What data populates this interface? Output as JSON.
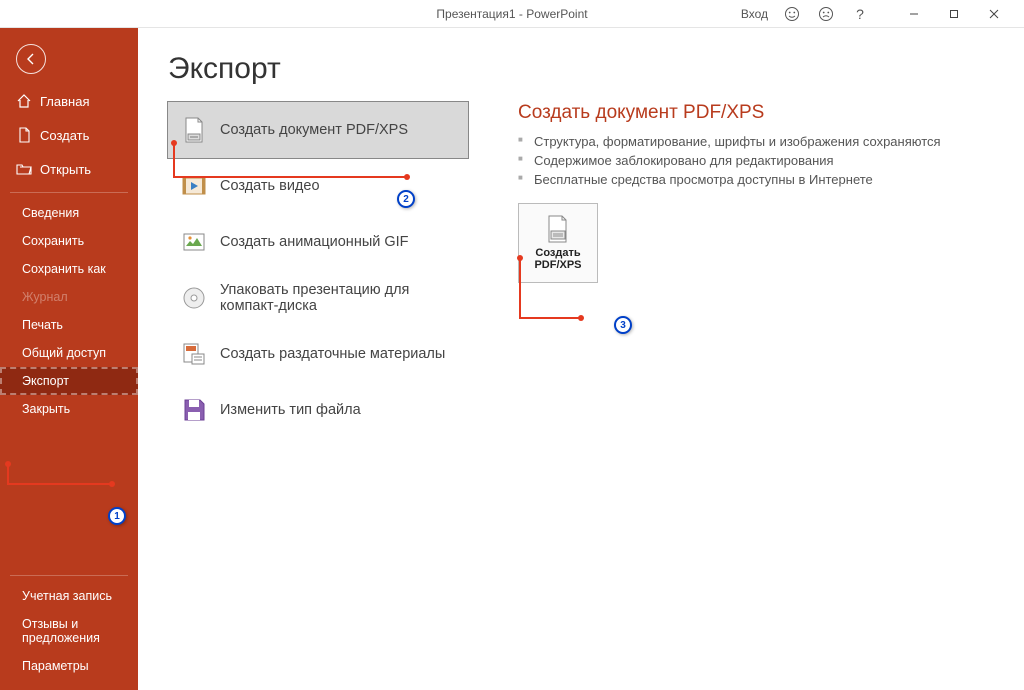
{
  "app": {
    "title": "Презентация1  -  PowerPoint",
    "signin": "Вход"
  },
  "sidebar": {
    "home": "Главная",
    "new": "Создать",
    "open": "Открыть",
    "info": "Сведения",
    "save": "Сохранить",
    "saveas": "Сохранить как",
    "history": "Журнал",
    "print": "Печать",
    "share": "Общий доступ",
    "export": "Экспорт",
    "close": "Закрыть",
    "account": "Учетная запись",
    "feedback": "Отзывы и предложения",
    "options": "Параметры"
  },
  "page": {
    "heading": "Экспорт",
    "options": {
      "pdf": "Создать документ PDF/XPS",
      "video": "Создать видео",
      "gif": "Создать анимационный GIF",
      "packcd": "Упаковать презентацию для компакт-диска",
      "handouts": "Создать раздаточные материалы",
      "changetype": "Изменить тип файла"
    }
  },
  "details": {
    "title": "Создать документ PDF/XPS",
    "b1": "Структура, форматирование, шрифты и изображения сохраняются",
    "b2": "Содержимое заблокировано для редактирования",
    "b3": "Бесплатные средства просмотра доступны в Интернете",
    "button": "Создать PDF/XPS"
  },
  "annotations": {
    "a1": "1",
    "a2": "2",
    "a3": "3"
  }
}
